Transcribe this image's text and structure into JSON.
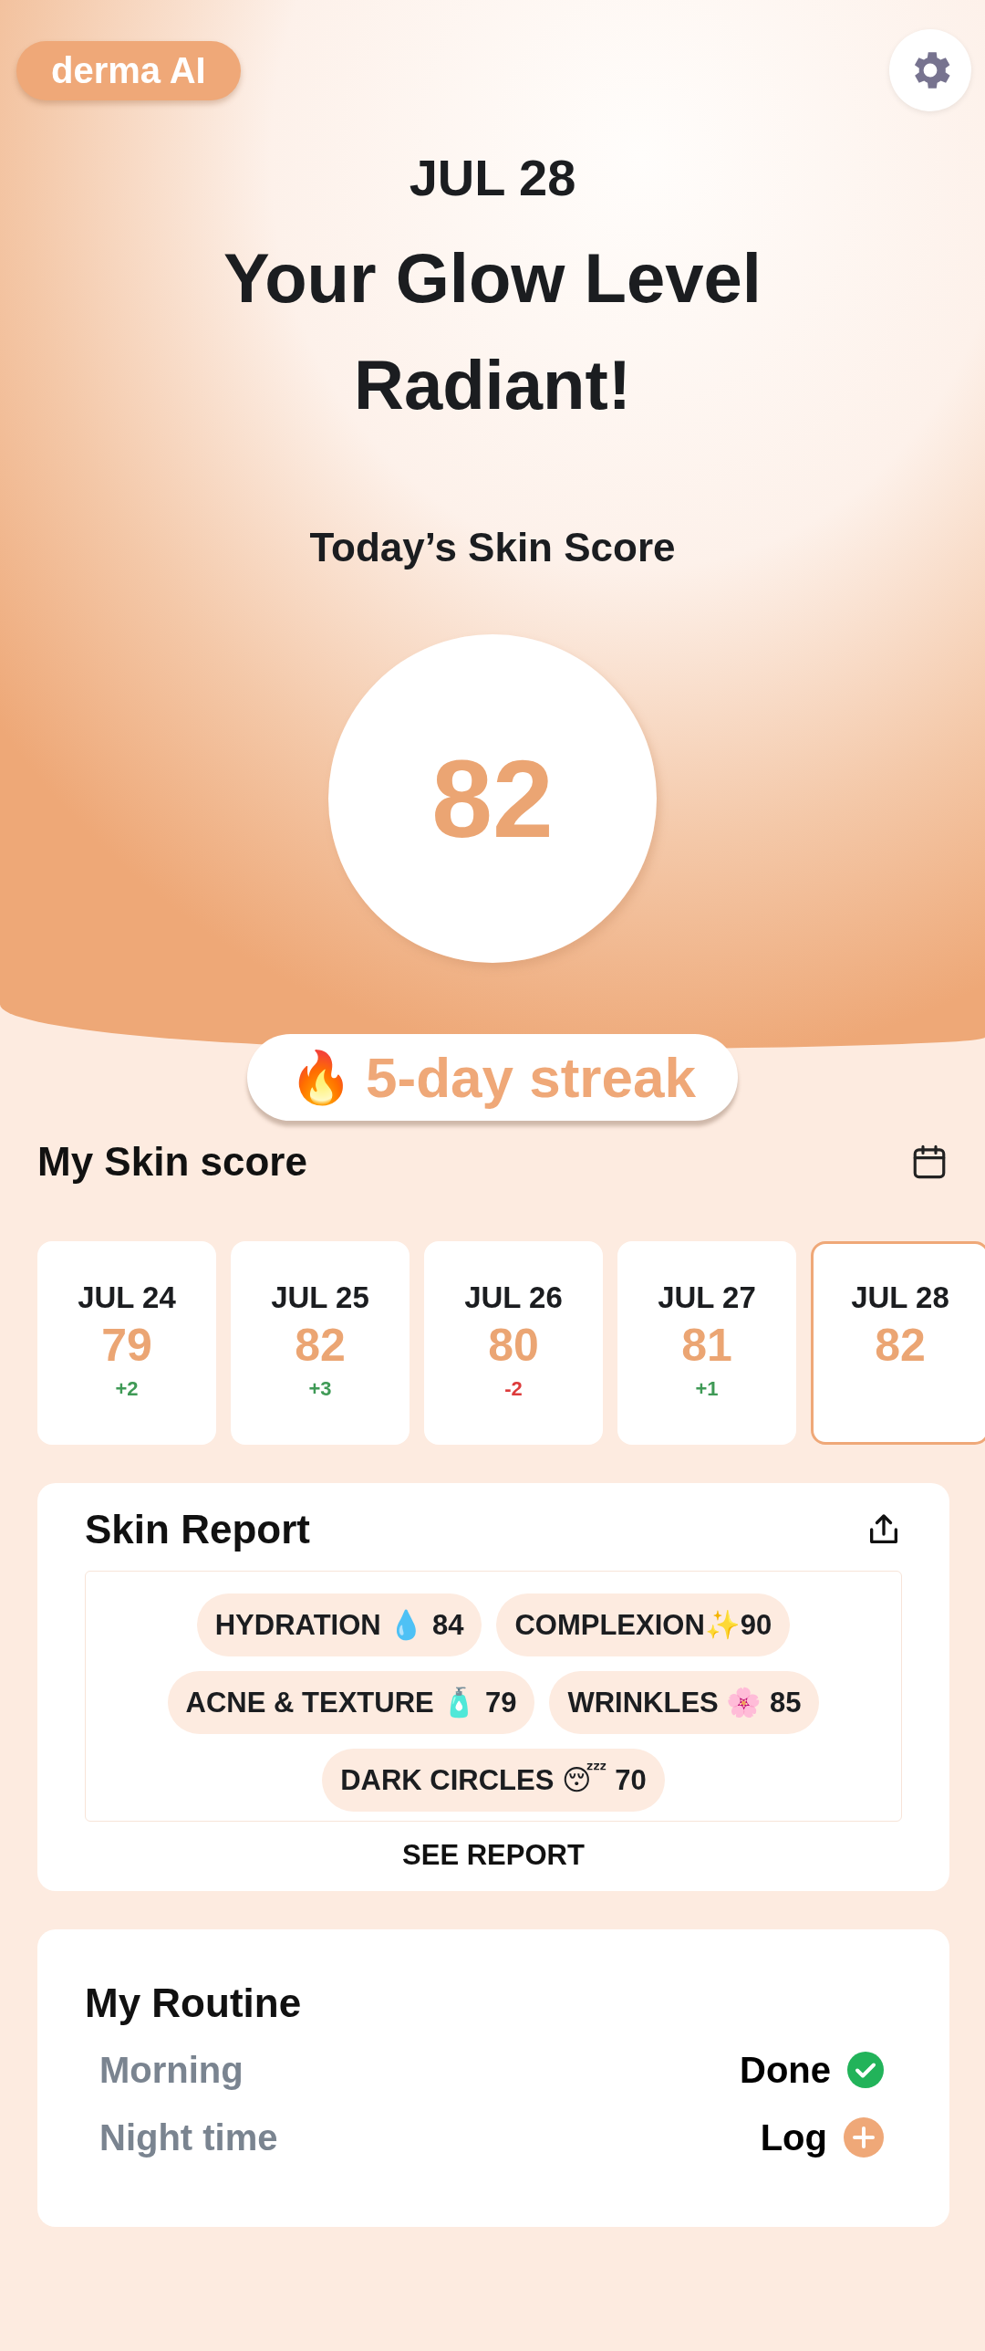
{
  "header": {
    "logo": "derma AI",
    "date": "JUL 28",
    "title": "Your Glow Level",
    "level_name": "Radiant!",
    "score_label": "Today’s Skin Score",
    "score": "82"
  },
  "streak": {
    "icon": "🔥",
    "label": "5-day streak"
  },
  "skin_score": {
    "title": "My Skin score",
    "days": [
      {
        "date": "JUL 24",
        "score": "79",
        "delta": "+2",
        "color": "#3f9a56",
        "selected": false
      },
      {
        "date": "JUL 25",
        "score": "82",
        "delta": "+3",
        "color": "#3f9a56",
        "selected": false
      },
      {
        "date": "JUL 26",
        "score": "80",
        "delta": "-2",
        "color": "#dd3b3b",
        "selected": false
      },
      {
        "date": "JUL 27",
        "score": "81",
        "delta": "+1",
        "color": "#3f9a56",
        "selected": false
      },
      {
        "date": "JUL 28",
        "score": "82",
        "selected": true
      }
    ]
  },
  "skin_report": {
    "title": "Skin Report",
    "metrics": [
      [
        "HYDRATION 💧 84",
        "COMPLEXION✨90"
      ],
      [
        "ACNE & TEXTURE 🧴 79",
        "WRINKLES 🌸 85"
      ],
      [
        "DARK CIRCLES 😴 70"
      ]
    ],
    "link": "SEE REPORT"
  },
  "routine": {
    "title": "My Routine",
    "items": [
      {
        "name": "Morning",
        "status": "Done",
        "kind": "done"
      },
      {
        "name": "Night time",
        "status": "Log",
        "kind": "log"
      }
    ]
  }
}
